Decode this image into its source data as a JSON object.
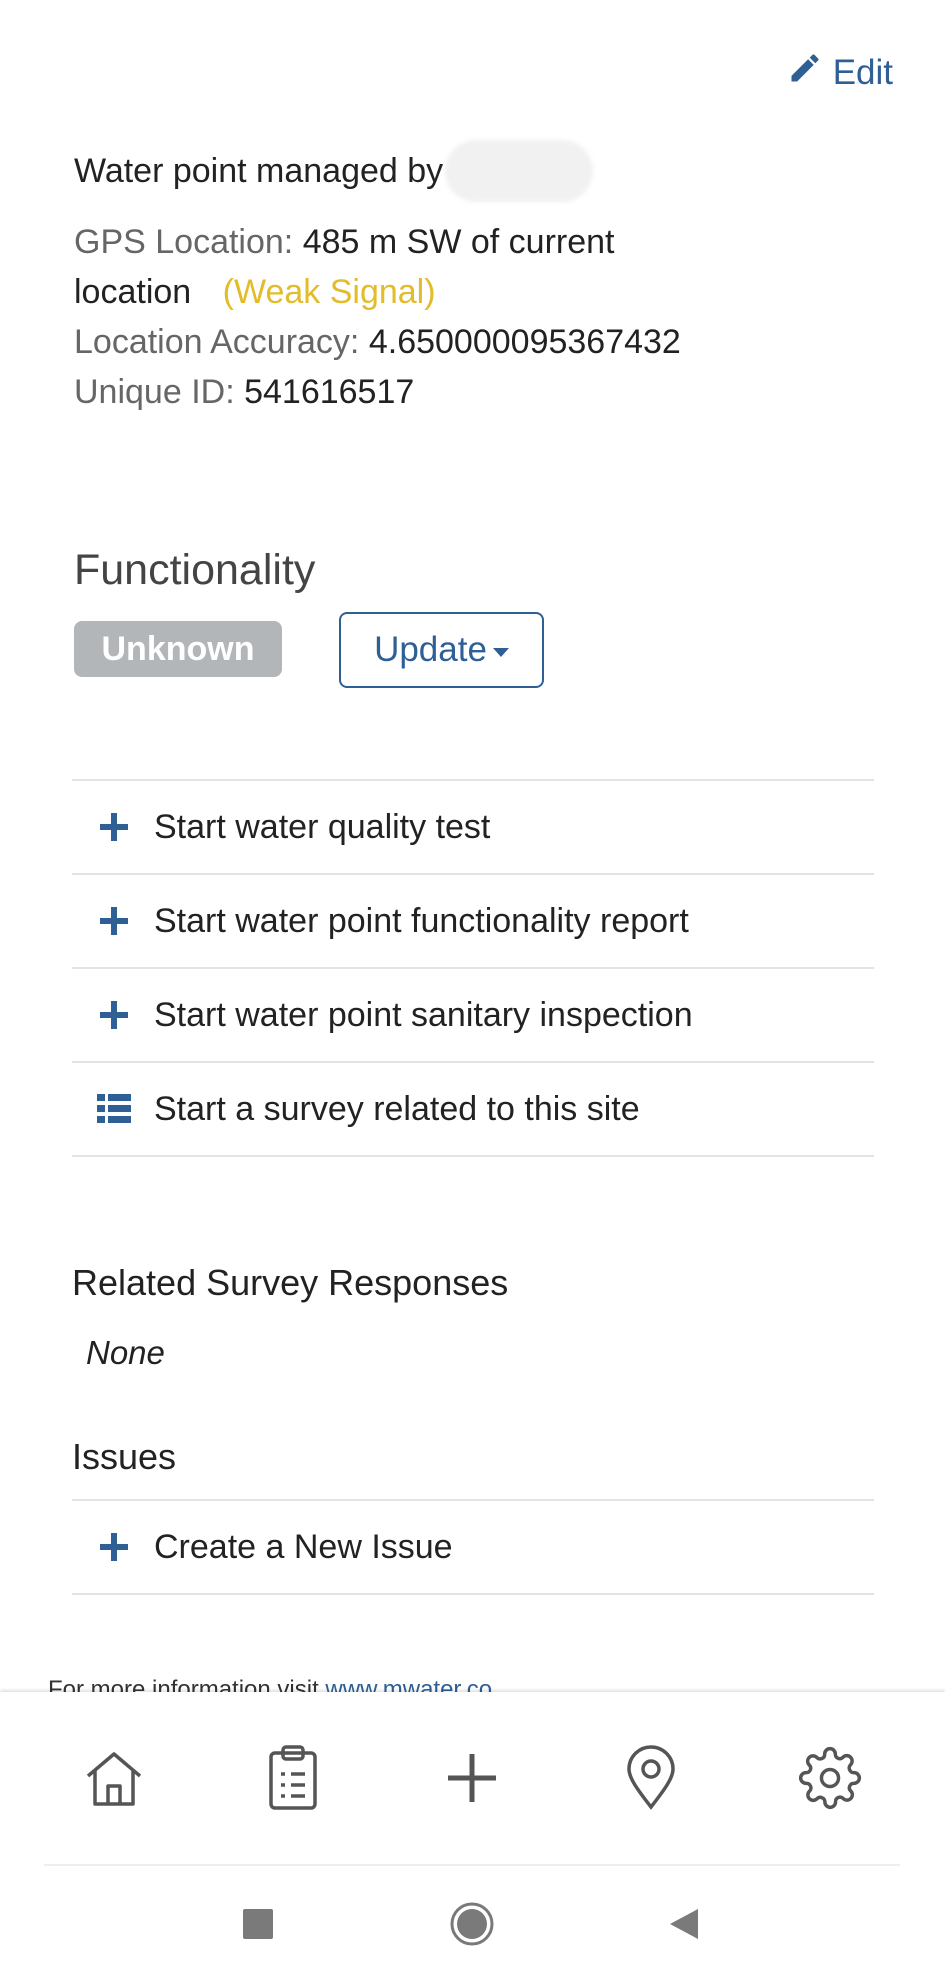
{
  "header": {
    "edit_label": "Edit"
  },
  "info": {
    "managed_by_label": "Water point managed by",
    "gps_label": "GPS Location:",
    "gps_value_line1": "485 m SW of current",
    "gps_value_line2": "location",
    "gps_signal": "(Weak Signal)",
    "accuracy_label": "Location Accuracy:",
    "accuracy_value": "4.650000095367432",
    "uid_label": "Unique ID:",
    "uid_value": "541616517"
  },
  "functionality": {
    "title": "Functionality",
    "status": "Unknown",
    "update_label": "Update"
  },
  "actions": [
    {
      "label": "Start water quality test",
      "icon": "plus-icon"
    },
    {
      "label": "Start water point functionality report",
      "icon": "plus-icon"
    },
    {
      "label": "Start water point sanitary inspection",
      "icon": "plus-icon"
    },
    {
      "label": "Start a survey related to this site",
      "icon": "list-icon"
    }
  ],
  "related": {
    "title": "Related Survey Responses",
    "none_label": "None"
  },
  "issues": {
    "title": "Issues",
    "create_label": "Create a New Issue"
  },
  "footer": {
    "text": "For more information visit ",
    "link": "www.mwater.co"
  },
  "bottom_nav": [
    "home-icon",
    "clipboard-icon",
    "add-icon",
    "map-pin-icon",
    "gear-icon"
  ],
  "colors": {
    "accent": "#2e6096",
    "warning": "#e3bc2a",
    "badge_grey": "#b3b6b9"
  }
}
